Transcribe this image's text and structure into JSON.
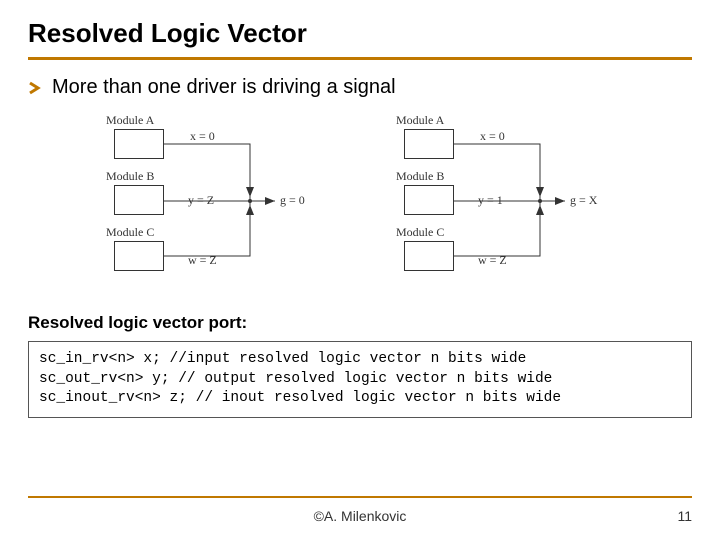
{
  "title": "Resolved Logic Vector",
  "bullet": "More than one driver is driving a signal",
  "diagram": {
    "modA": "Module A",
    "modB": "Module B",
    "modC": "Module C",
    "left": {
      "sigA": "x = 0",
      "sigB": "y = Z",
      "sigC": "w = Z",
      "out": "g = 0"
    },
    "right": {
      "sigA": "x = 0",
      "sigB": "y = 1",
      "sigC": "w = Z",
      "out": "g = X"
    }
  },
  "subheading": "Resolved logic vector port:",
  "code": {
    "l1": "sc_in_rv<n> x; //input resolved logic vector n bits wide",
    "l2": "sc_out_rv<n> y; // output resolved logic vector n bits wide",
    "l3": "sc_inout_rv<n> z; // inout resolved logic vector n bits wide"
  },
  "footer": {
    "author": "©A. Milenkovic",
    "page": "11"
  }
}
